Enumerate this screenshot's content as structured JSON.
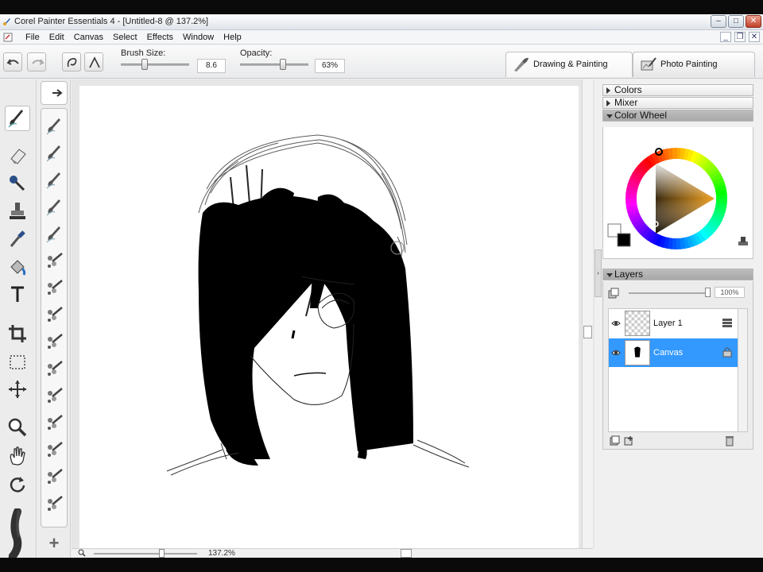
{
  "window": {
    "title": "Corel Painter Essentials 4 - [Untitled-8 @ 137.2%]",
    "minimize": "–",
    "maximize": "□",
    "close": "✕"
  },
  "menu": {
    "items": [
      "File",
      "Edit",
      "Canvas",
      "Select",
      "Effects",
      "Window",
      "Help"
    ],
    "mdi_minimize": "_",
    "mdi_restore": "❐",
    "mdi_close": "✕"
  },
  "properties": {
    "brush_size_label": "Brush Size:",
    "brush_size_value": "8.6",
    "brush_size_fraction": 0.35,
    "opacity_label": "Opacity:",
    "opacity_value": "63%",
    "opacity_fraction": 0.63
  },
  "workspace_tabs": {
    "drawing": "Drawing & Painting",
    "photo": "Photo Painting",
    "active": "drawing"
  },
  "panels": {
    "colors": "Colors",
    "mixer": "Mixer",
    "color_wheel": "Color Wheel",
    "layers": "Layers",
    "layers_opacity": "100%",
    "main_color": "#000000",
    "additional_color": "#ffffff"
  },
  "layers": [
    {
      "name": "Layer 1",
      "selected": false
    },
    {
      "name": "Canvas",
      "selected": true
    }
  ],
  "status": {
    "zoom": "137.2%"
  },
  "colors": {
    "selection": "#3399ff",
    "window_bg": "#f0f0f0"
  }
}
